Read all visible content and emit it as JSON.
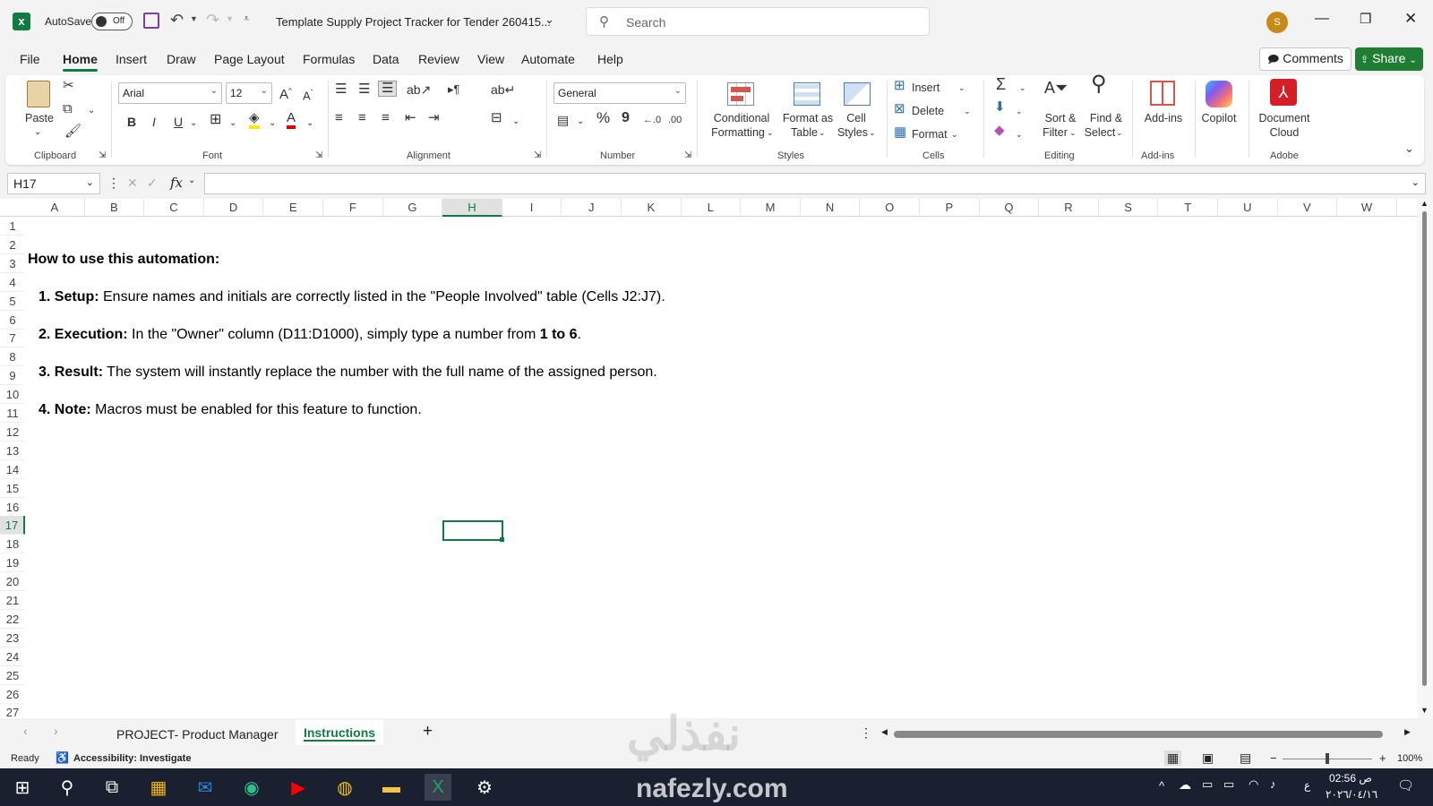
{
  "titlebar": {
    "autosave_label": "AutoSave",
    "autosave_state": "Off",
    "doc_title": "Template Supply Project Tracker for Tender 260415...",
    "search_placeholder": "Search",
    "avatar_initial": "S"
  },
  "menu_tabs": [
    "File",
    "Home",
    "Insert",
    "Draw",
    "Page Layout",
    "Formulas",
    "Data",
    "Review",
    "View",
    "Automate",
    "Help"
  ],
  "active_tab": "Home",
  "top_buttons": {
    "comments": "Comments",
    "share": "Share"
  },
  "ribbon": {
    "clipboard": {
      "paste": "Paste",
      "label": "Clipboard"
    },
    "font": {
      "name": "Arial",
      "size": "12",
      "label": "Font",
      "bold": "B",
      "italic": "I",
      "underline": "U"
    },
    "alignment": {
      "label": "Alignment"
    },
    "number": {
      "format": "General",
      "label": "Number",
      "percent": "%",
      "comma": "9"
    },
    "styles": {
      "conditional": [
        "Conditional",
        "Formatting"
      ],
      "format_table": [
        "Format as",
        "Table"
      ],
      "cell_styles": [
        "Cell",
        "Styles"
      ],
      "label": "Styles"
    },
    "cells": {
      "insert": "Insert",
      "delete": "Delete",
      "format": "Format",
      "label": "Cells"
    },
    "editing": {
      "sort": [
        "Sort &",
        "Filter"
      ],
      "find": [
        "Find &",
        "Select"
      ],
      "label": "Editing",
      "sum": "Σ"
    },
    "addins": {
      "addins": "Add-ins",
      "label": "Add-ins"
    },
    "copilot": {
      "label": "Copilot"
    },
    "adobe": {
      "doc": [
        "Document",
        "Cloud"
      ],
      "label": "Adobe"
    }
  },
  "formula_bar": {
    "name_box": "H17",
    "fx": "fx"
  },
  "columns": [
    "A",
    "B",
    "C",
    "D",
    "E",
    "F",
    "G",
    "H",
    "I",
    "J",
    "K",
    "L",
    "M",
    "N",
    "O",
    "P",
    "Q",
    "R",
    "S",
    "T",
    "U",
    "V",
    "W"
  ],
  "selected_column": "H",
  "rows": [
    "1",
    "2",
    "3",
    "4",
    "5",
    "6",
    "7",
    "8",
    "9",
    "10",
    "11",
    "12",
    "13",
    "14",
    "15",
    "16",
    "17",
    "18",
    "19",
    "20",
    "21",
    "22",
    "23",
    "24",
    "25",
    "26",
    "27"
  ],
  "selected_row": "17",
  "content": {
    "heading": "How to use this automation:",
    "items": [
      {
        "bold": "1. Setup:",
        "text": " Ensure names and initials are correctly listed in the \"People Involved\" table (Cells J2:J7)."
      },
      {
        "bold": "2. Execution:",
        "text": " In the \"Owner\" column (D11:D1000), simply type a number from ",
        "bold2": "1 to 6",
        "tail": "."
      },
      {
        "bold": "3. Result:",
        "text": " The system will instantly replace the number with the full name of the assigned person."
      },
      {
        "bold": "4. Note:",
        "text": " Macros must be enabled for this feature to function."
      }
    ]
  },
  "sheet_tabs": {
    "tab1": "PROJECT- Product Manager",
    "tab2": "Instructions",
    "add": "+"
  },
  "status": {
    "ready": "Ready",
    "accessibility": "Accessibility: Investigate",
    "zoom": "100%"
  },
  "taskbar": {
    "time": "02:56 ص",
    "date": "٢٠٢٦/٠٤/١٦",
    "lang": "ع"
  },
  "watermark": {
    "arabic": "نفذلي",
    "latin": "nafezly.com"
  },
  "colors": {
    "excel_green": "#107c41",
    "share_green": "#1e7e34",
    "adobe_red": "#d51f27"
  }
}
